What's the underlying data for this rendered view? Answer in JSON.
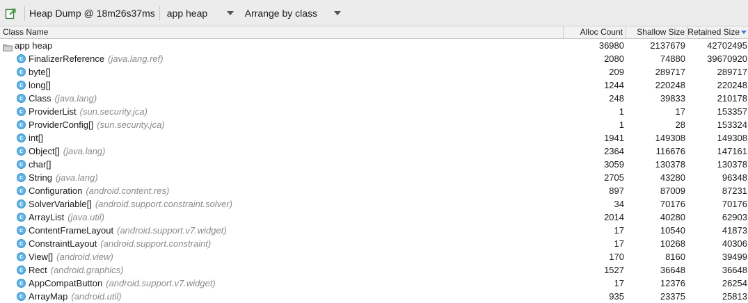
{
  "toolbar": {
    "title": "Heap Dump @ 18m26s37ms",
    "heap_select": "app heap",
    "arrange_select": "Arrange by class"
  },
  "columns": {
    "name": "Class Name",
    "alloc": "Alloc Count",
    "shallow": "Shallow Size",
    "retained": "Retained Size"
  },
  "root": {
    "name": "app heap",
    "alloc": "36980",
    "shallow": "2137679",
    "retained": "42702495"
  },
  "rows": [
    {
      "name": "FinalizerReference",
      "pkg": "(java.lang.ref)",
      "alloc": "2080",
      "shallow": "74880",
      "retained": "39670920"
    },
    {
      "name": "byte[]",
      "pkg": "",
      "alloc": "209",
      "shallow": "289717",
      "retained": "289717"
    },
    {
      "name": "long[]",
      "pkg": "",
      "alloc": "1244",
      "shallow": "220248",
      "retained": "220248"
    },
    {
      "name": "Class",
      "pkg": "(java.lang)",
      "alloc": "248",
      "shallow": "39833",
      "retained": "210178"
    },
    {
      "name": "ProviderList",
      "pkg": "(sun.security.jca)",
      "alloc": "1",
      "shallow": "17",
      "retained": "153357"
    },
    {
      "name": "ProviderConfig[]",
      "pkg": "(sun.security.jca)",
      "alloc": "1",
      "shallow": "28",
      "retained": "153324"
    },
    {
      "name": "int[]",
      "pkg": "",
      "alloc": "1941",
      "shallow": "149308",
      "retained": "149308"
    },
    {
      "name": "Object[]",
      "pkg": "(java.lang)",
      "alloc": "2364",
      "shallow": "116676",
      "retained": "147161"
    },
    {
      "name": "char[]",
      "pkg": "",
      "alloc": "3059",
      "shallow": "130378",
      "retained": "130378"
    },
    {
      "name": "String",
      "pkg": "(java.lang)",
      "alloc": "2705",
      "shallow": "43280",
      "retained": "96348"
    },
    {
      "name": "Configuration",
      "pkg": "(android.content.res)",
      "alloc": "897",
      "shallow": "87009",
      "retained": "87231"
    },
    {
      "name": "SolverVariable[]",
      "pkg": "(android.support.constraint.solver)",
      "alloc": "34",
      "shallow": "70176",
      "retained": "70176"
    },
    {
      "name": "ArrayList",
      "pkg": "(java.util)",
      "alloc": "2014",
      "shallow": "40280",
      "retained": "62903"
    },
    {
      "name": "ContentFrameLayout",
      "pkg": "(android.support.v7.widget)",
      "alloc": "17",
      "shallow": "10540",
      "retained": "41873"
    },
    {
      "name": "ConstraintLayout",
      "pkg": "(android.support.constraint)",
      "alloc": "17",
      "shallow": "10268",
      "retained": "40306"
    },
    {
      "name": "View[]",
      "pkg": "(android.view)",
      "alloc": "170",
      "shallow": "8160",
      "retained": "39499"
    },
    {
      "name": "Rect",
      "pkg": "(android.graphics)",
      "alloc": "1527",
      "shallow": "36648",
      "retained": "36648"
    },
    {
      "name": "AppCompatButton",
      "pkg": "(android.support.v7.widget)",
      "alloc": "17",
      "shallow": "12376",
      "retained": "26254"
    },
    {
      "name": "ArrayMap",
      "pkg": "(android.util)",
      "alloc": "935",
      "shallow": "23375",
      "retained": "25813"
    }
  ],
  "icons": {
    "class_icon_letter": "c",
    "class_icon_color": "#5fb4e6",
    "sort_arrow_color": "#3d7ad6",
    "export_icon": "export-heap-icon",
    "folder_icon": "folder-icon"
  }
}
